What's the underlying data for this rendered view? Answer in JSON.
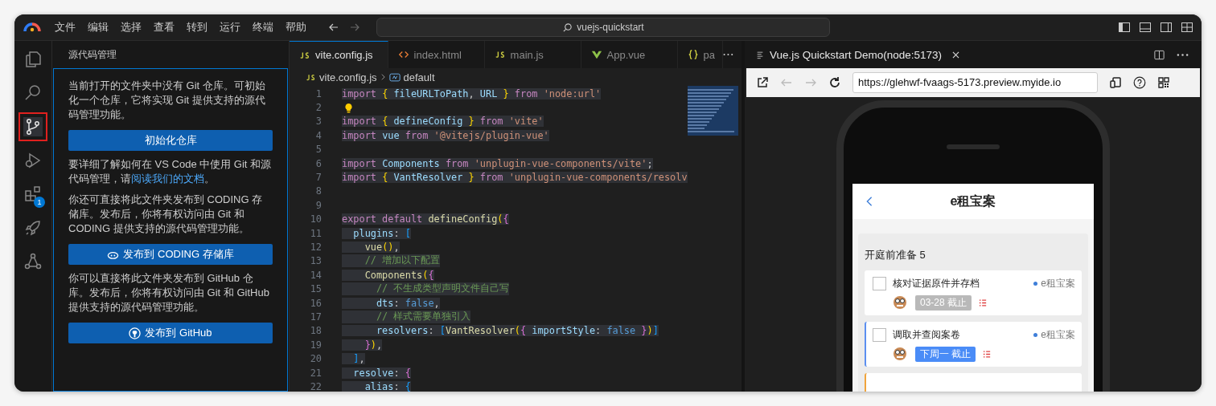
{
  "title_bar": {
    "menu": [
      "文件",
      "编辑",
      "选择",
      "查看",
      "转到",
      "运行",
      "终端",
      "帮助"
    ],
    "search": "vuejs-quickstart"
  },
  "activity_bar": [
    {
      "kind": "explorer",
      "selected": false
    },
    {
      "kind": "search",
      "selected": false
    },
    {
      "kind": "source-control",
      "selected": true
    },
    {
      "kind": "debug",
      "selected": false
    },
    {
      "kind": "extensions",
      "selected": false,
      "badge": "1"
    },
    {
      "kind": "rocket",
      "selected": false
    },
    {
      "kind": "share",
      "selected": false
    }
  ],
  "sidebar": {
    "title": "源代码管理",
    "blocks": [
      {
        "kind": "text",
        "text": "当前打开的文件夹中没有 Git 仓库。可初始化一个仓库，它将实现 Git 提供支持的源代码管理功能。"
      },
      {
        "kind": "button",
        "label": "初始化仓库"
      },
      {
        "kind": "link-text",
        "before": "要详细了解如何在 VS Code 中使用 Git 和源代码管理，请",
        "link": "阅读我们的文档",
        "after": "。"
      },
      {
        "kind": "text",
        "text": "你还可直接将此文件夹发布到 CODING 存储库。发布后，你将有权访问由 Git 和 CODING 提供支持的源代码管理功能。"
      },
      {
        "kind": "coding-button",
        "label": "发布到 CODING 存储库"
      },
      {
        "kind": "text",
        "text": "你可以直接将此文件夹发布到 GitHub 仓库。发布后，你将有权访问由 Git 和 GitHub 提供支持的源代码管理功能。"
      },
      {
        "kind": "github-button",
        "label": "发布到 GitHub"
      }
    ]
  },
  "editor": {
    "tabs": [
      {
        "label": "vite.config.js",
        "kind": "js",
        "selected": true
      },
      {
        "label": "index.html",
        "kind": "html",
        "selected": false
      },
      {
        "label": "main.js",
        "kind": "js",
        "selected": false
      },
      {
        "label": "App.vue",
        "kind": "vue",
        "selected": false
      },
      {
        "label": "pa",
        "kind": "json",
        "selected": false
      }
    ],
    "breadcrumb": {
      "file": "vite.config.js",
      "symbol": "default"
    },
    "lines": [
      {
        "number": "1",
        "tokens": [
          {
            "kind": "kw",
            "text": "import "
          },
          {
            "kind": "b1",
            "text": "{ "
          },
          {
            "kind": "var",
            "text": "fileURLToPath"
          },
          {
            "kind": "p",
            "text": ", "
          },
          {
            "kind": "var",
            "text": "URL "
          },
          {
            "kind": "b1",
            "text": "} "
          },
          {
            "kind": "kw",
            "text": "from "
          },
          {
            "kind": "str",
            "text": "'node:url'"
          }
        ]
      },
      {
        "number": "2",
        "lightbulb": true
      },
      {
        "number": "3",
        "tokens": [
          {
            "kind": "kw",
            "text": "import "
          },
          {
            "kind": "b1",
            "text": "{ "
          },
          {
            "kind": "var",
            "text": "defineConfig "
          },
          {
            "kind": "b1",
            "text": "} "
          },
          {
            "kind": "kw",
            "text": "from "
          },
          {
            "kind": "str",
            "text": "'vite'"
          }
        ]
      },
      {
        "number": "4",
        "tokens": [
          {
            "kind": "kw",
            "text": "import "
          },
          {
            "kind": "var",
            "text": "vue "
          },
          {
            "kind": "kw",
            "text": "from "
          },
          {
            "kind": "str",
            "text": "'@vitejs/plugin-vue'"
          }
        ]
      },
      {
        "number": "5"
      },
      {
        "number": "6",
        "tokens": [
          {
            "kind": "kw",
            "text": "import "
          },
          {
            "kind": "cls",
            "text": "Components "
          },
          {
            "kind": "kw",
            "text": "from "
          },
          {
            "kind": "str",
            "text": "'unplugin-vue-components/vite'"
          },
          {
            "kind": "p",
            "text": ";"
          }
        ]
      },
      {
        "number": "7",
        "tokens": [
          {
            "kind": "kw",
            "text": "import "
          },
          {
            "kind": "b1",
            "text": "{ "
          },
          {
            "kind": "cls",
            "text": "VantResolver "
          },
          {
            "kind": "b1",
            "text": "} "
          },
          {
            "kind": "kw",
            "text": "from "
          },
          {
            "kind": "str",
            "text": "'unplugin-vue-components/resolv"
          }
        ]
      },
      {
        "number": "8"
      },
      {
        "number": "9"
      },
      {
        "number": "10",
        "tokens": [
          {
            "kind": "kw",
            "text": "export default "
          },
          {
            "kind": "fn",
            "text": "defineConfig"
          },
          {
            "kind": "b1",
            "text": "("
          },
          {
            "kind": "b2",
            "text": "{"
          }
        ]
      },
      {
        "number": "11",
        "tokens": [
          {
            "kind": "var",
            "text": "  plugins"
          },
          {
            "kind": "p",
            "text": ": "
          },
          {
            "kind": "b3",
            "text": "["
          }
        ]
      },
      {
        "number": "12",
        "tokens": [
          {
            "kind": "fn",
            "text": "    vue"
          },
          {
            "kind": "b1",
            "text": "()"
          },
          {
            "kind": "p",
            "text": ","
          }
        ]
      },
      {
        "number": "13",
        "tokens": [
          {
            "kind": "cm",
            "text": "    // 增加以下配置"
          }
        ]
      },
      {
        "number": "14",
        "tokens": [
          {
            "kind": "fn",
            "text": "    Components"
          },
          {
            "kind": "b1",
            "text": "("
          },
          {
            "kind": "b2",
            "text": "{"
          }
        ]
      },
      {
        "number": "15",
        "tokens": [
          {
            "kind": "cm",
            "text": "      // 不生成类型声明文件自己写"
          }
        ]
      },
      {
        "number": "16",
        "tokens": [
          {
            "kind": "var",
            "text": "      dts"
          },
          {
            "kind": "p",
            "text": ": "
          },
          {
            "kind": "bool",
            "text": "false"
          },
          {
            "kind": "p",
            "text": ","
          }
        ]
      },
      {
        "number": "17",
        "tokens": [
          {
            "kind": "cm",
            "text": "      // 样式需要单独引入"
          }
        ]
      },
      {
        "number": "18",
        "tokens": [
          {
            "kind": "var",
            "text": "      resolvers"
          },
          {
            "kind": "p",
            "text": ": "
          },
          {
            "kind": "b3",
            "text": "["
          },
          {
            "kind": "fn",
            "text": "VantResolver"
          },
          {
            "kind": "b1",
            "text": "("
          },
          {
            "kind": "b2",
            "text": "{ "
          },
          {
            "kind": "var",
            "text": "importStyle"
          },
          {
            "kind": "p",
            "text": ": "
          },
          {
            "kind": "bool",
            "text": "false "
          },
          {
            "kind": "b2",
            "text": "}"
          },
          {
            "kind": "b1",
            "text": ")"
          },
          {
            "kind": "b3",
            "text": "]"
          }
        ]
      },
      {
        "number": "19",
        "tokens": [
          {
            "kind": "b2",
            "text": "    }"
          },
          {
            "kind": "b1",
            "text": ")"
          },
          {
            "kind": "p",
            "text": ","
          }
        ]
      },
      {
        "number": "20",
        "tokens": [
          {
            "kind": "b3",
            "text": "  ]"
          },
          {
            "kind": "p",
            "text": ","
          }
        ]
      },
      {
        "number": "21",
        "tokens": [
          {
            "kind": "var",
            "text": "  resolve"
          },
          {
            "kind": "p",
            "text": ": "
          },
          {
            "kind": "b2",
            "text": "{"
          }
        ]
      },
      {
        "number": "22",
        "tokens": [
          {
            "kind": "var",
            "text": "    alias"
          },
          {
            "kind": "p",
            "text": ": "
          },
          {
            "kind": "b3",
            "text": "{"
          }
        ]
      }
    ]
  },
  "preview": {
    "tab": {
      "label": "Vue.js Quickstart Demo(node:5173)"
    },
    "url": "https://glehwf-fvaags-5173.preview.myide.io",
    "app": {
      "title": "e租宝案",
      "section": "开庭前准备 5",
      "tasks": [
        {
          "kind": "overdue",
          "title": "核对证据原件并存档",
          "checked": false,
          "project": "e租宝案",
          "deadline": "03-28 截止"
        },
        {
          "kind": "due-soon",
          "title": "调取并查阅案卷",
          "checked": false,
          "project": "e租宝案",
          "deadline": "下周一 截止",
          "color": "#5b8ff0"
        },
        {
          "kind": "partial",
          "color": "#f0a43c"
        }
      ]
    }
  }
}
